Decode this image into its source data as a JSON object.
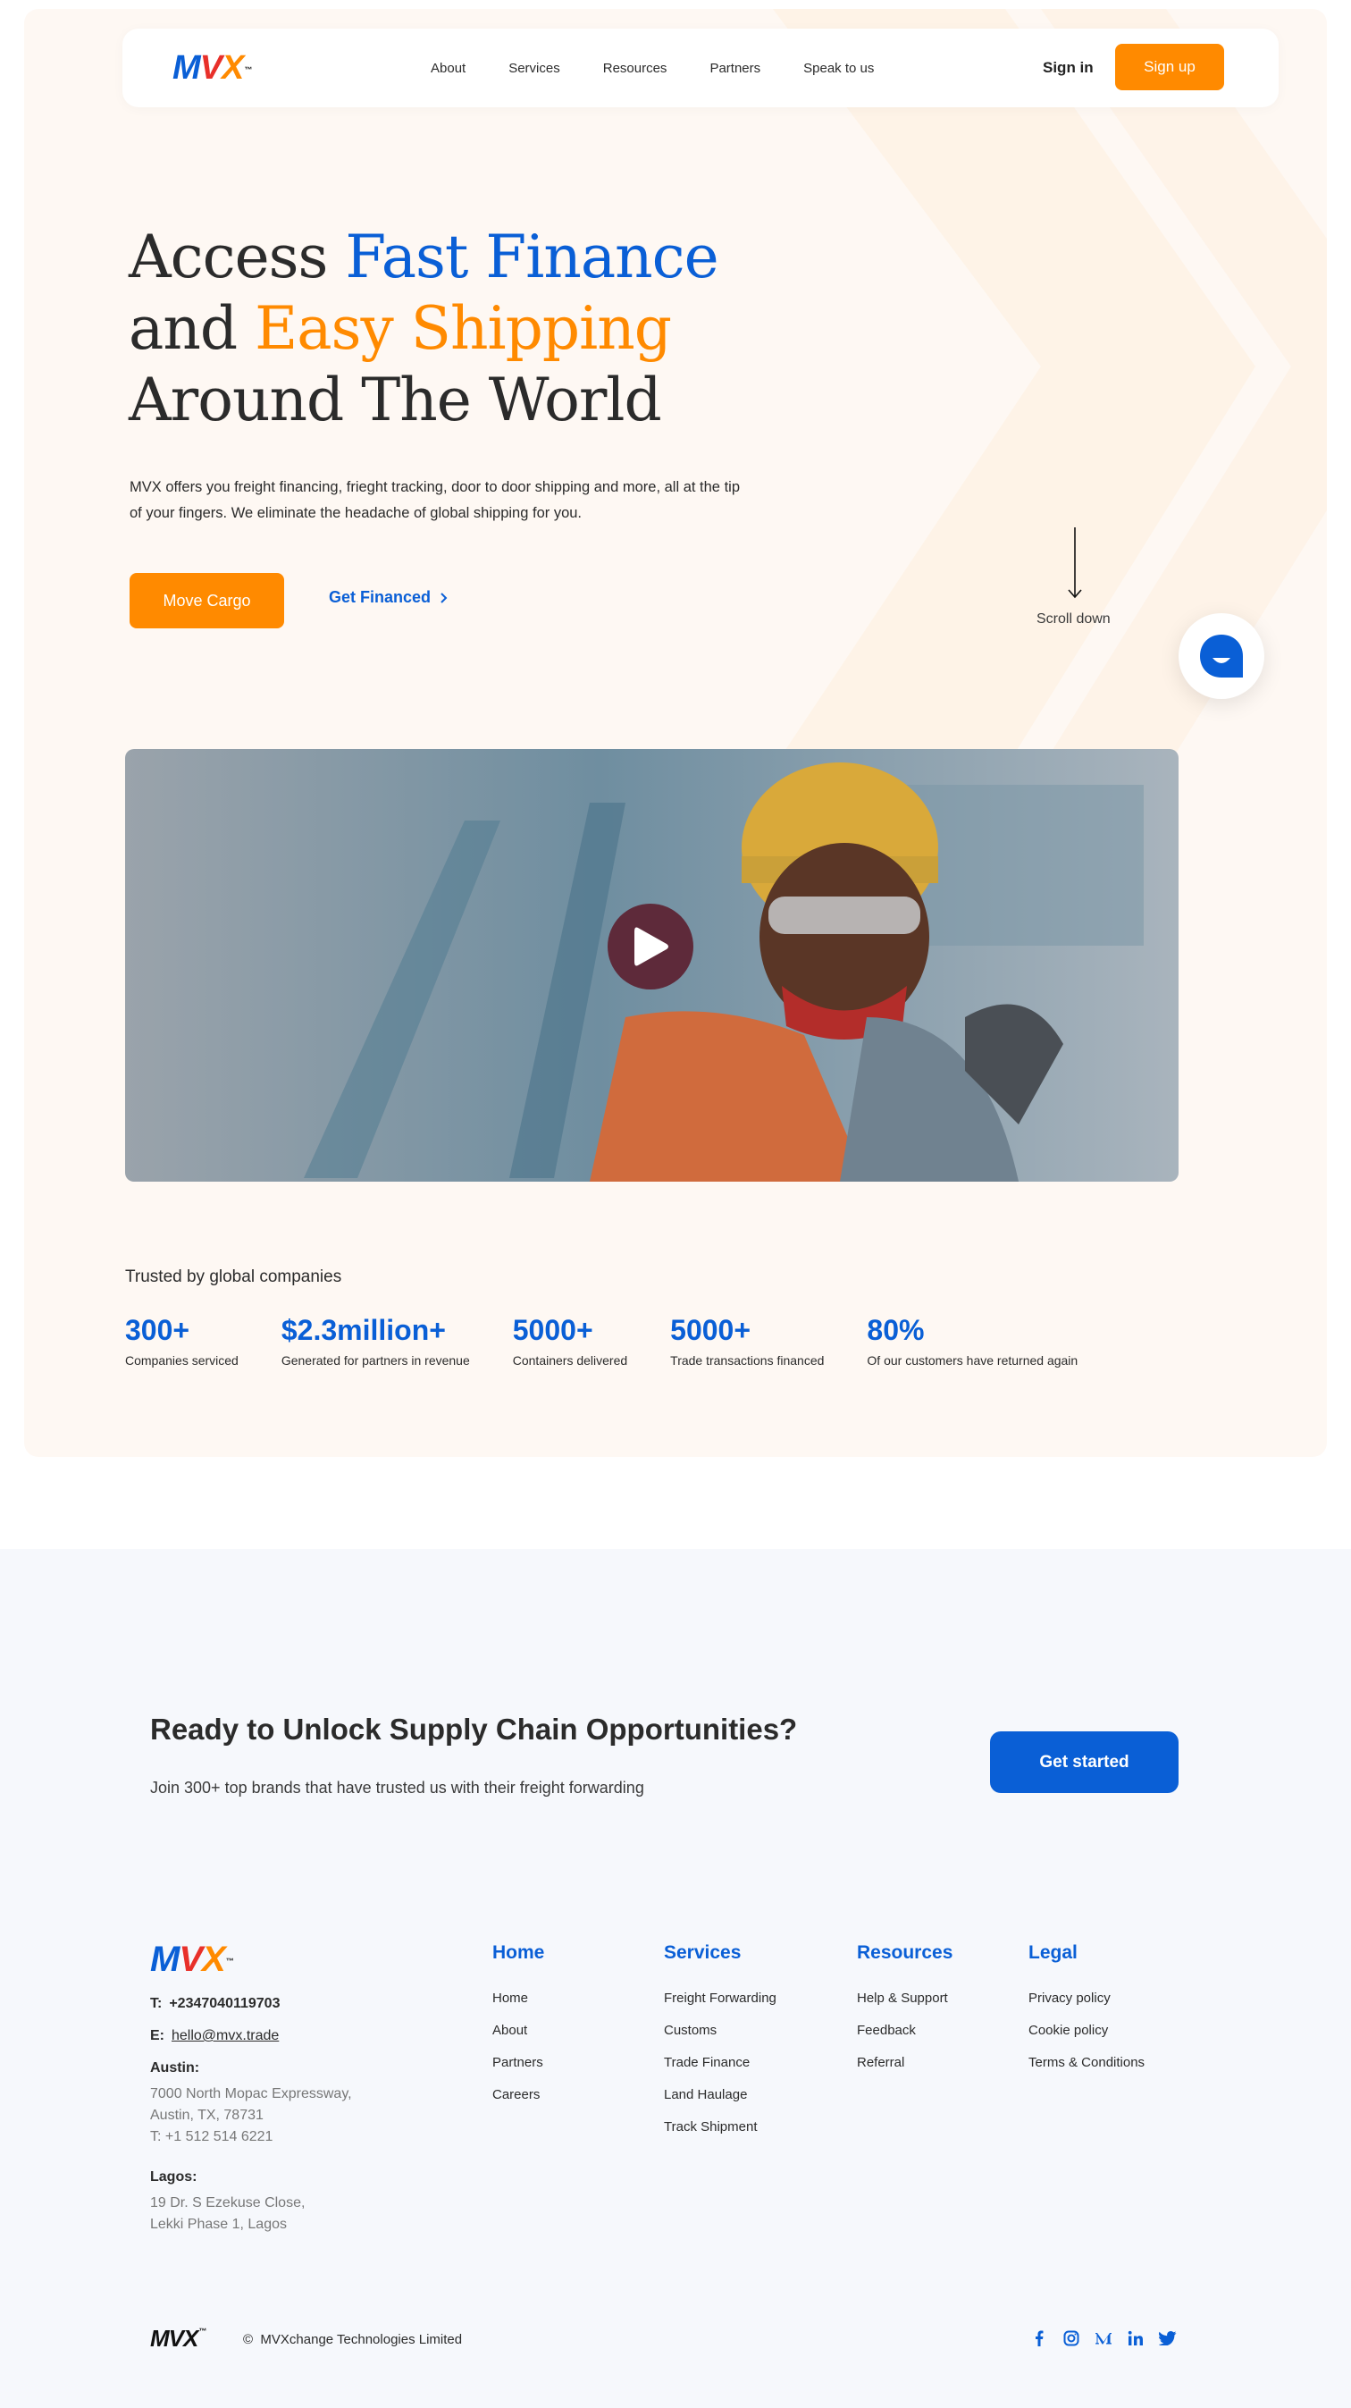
{
  "brand": {
    "logo_m": "M",
    "logo_v": "V",
    "logo_x": "X",
    "tm": "™",
    "blue": "#0a5fd6",
    "orange": "#ff8a00",
    "red": "#e8302a"
  },
  "nav": {
    "links": [
      "About",
      "Services",
      "Resources",
      "Partners",
      "Speak to us"
    ],
    "signin": "Sign in",
    "signup": "Sign up"
  },
  "hero": {
    "line1_a": "Access ",
    "line1_b": "Fast Finance",
    "line2_a": "and ",
    "line2_b": "Easy Shipping",
    "line3": "Around The World",
    "subtext": "MVX offers you freight financing, frieght tracking, door to door shipping and more, all at the tip of your fingers. We eliminate the headache of global shipping for you.",
    "btn_primary": "Move Cargo",
    "btn_secondary": "Get Financed",
    "scroll": "Scroll down"
  },
  "stats": {
    "title": "Trusted by global companies",
    "items": [
      {
        "value": "300+",
        "label": "Companies serviced"
      },
      {
        "value": "$2.3million+",
        "label": "Generated for partners in revenue"
      },
      {
        "value": "5000+",
        "label": "Containers delivered"
      },
      {
        "value": "5000+",
        "label": "Trade transactions financed"
      },
      {
        "value": "80%",
        "label": "Of our customers have returned again"
      }
    ]
  },
  "cta": {
    "title": "Ready to Unlock Supply Chain Opportunities?",
    "subtitle": "Join 300+ top brands that have trusted us with their freight forwarding",
    "button": "Get started"
  },
  "footer": {
    "phone_key": "T:",
    "phone": "+2347040119703",
    "email_key": "E:",
    "email": "hello@mvx.trade",
    "austin_label": "Austin:",
    "austin_addr1": "7000 North Mopac Expressway,",
    "austin_addr2": "Austin, TX, 78731",
    "austin_phone": "T:  +1 512 514 6221",
    "lagos_label": "Lagos:",
    "lagos_addr1": "19 Dr. S Ezekuse Close,",
    "lagos_addr2": "Lekki Phase 1, Lagos",
    "columns": [
      {
        "title": "Home",
        "items": [
          "Home",
          "About",
          "Partners",
          "Careers"
        ]
      },
      {
        "title": "Services",
        "items": [
          "Freight Forwarding",
          "Customs",
          "Trade Finance",
          "Land Haulage",
          "Track Shipment"
        ]
      },
      {
        "title": "Resources",
        "items": [
          "Help & Support",
          "Feedback",
          "Referral"
        ]
      },
      {
        "title": "Legal",
        "items": [
          "Privacy policy",
          "Cookie policy",
          "Terms & Conditions"
        ]
      }
    ],
    "copyright_symbol": "©",
    "copyright": "MVXchange Technologies Limited",
    "socials": [
      "facebook-icon",
      "instagram-icon",
      "medium-icon",
      "linkedin-icon",
      "twitter-icon"
    ]
  }
}
